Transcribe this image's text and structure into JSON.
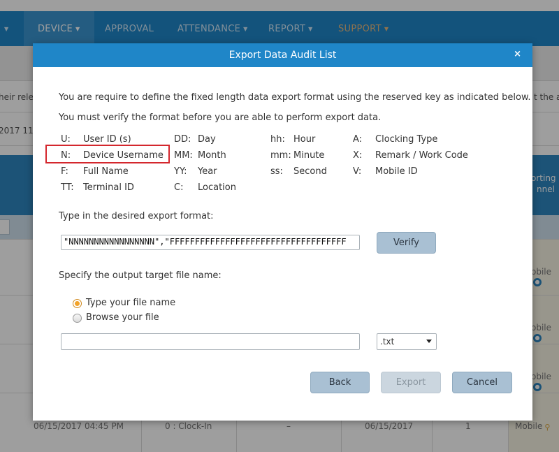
{
  "nav": {
    "items": [
      {
        "label": "DEVICE",
        "caret": "▼"
      },
      {
        "label": "APPROVAL",
        "caret": ""
      },
      {
        "label": "ATTENDANCE",
        "caret": "▼"
      },
      {
        "label": "REPORT",
        "caret": "▼"
      },
      {
        "label": "SUPPORT",
        "caret": "▼"
      }
    ],
    "left_caret": "▼"
  },
  "background": {
    "partial_text_left": "heir rele",
    "partial_text_right": "t the a",
    "date_partial": "2017 11:",
    "column_header_partial_1": "orting",
    "column_header_partial_2": "nnel",
    "channel_values": [
      "obile",
      "obile",
      "obile",
      "Mobile"
    ],
    "last_row": {
      "datetime": "06/15/2017 04:45 PM",
      "type": "0 : Clock-In",
      "dash": "–",
      "date": "06/15/2017",
      "count": "1"
    }
  },
  "dialog": {
    "title": "Export Data Audit List",
    "close": "×",
    "intro1": "You are require to define the fixed length data export format using the reserved key as indicated below.",
    "intro2": "You must verify the format before you are able to perform export data.",
    "keys": [
      [
        {
          "k": "U:",
          "v": "User ID (s)"
        },
        {
          "k": "DD:",
          "v": "Day"
        },
        {
          "k": "hh:",
          "v": "Hour"
        },
        {
          "k": "A:",
          "v": "Clocking Type"
        }
      ],
      [
        {
          "k": "N:",
          "v": "Device Username"
        },
        {
          "k": "MM:",
          "v": "Month"
        },
        {
          "k": "mm:",
          "v": "Minute"
        },
        {
          "k": "X:",
          "v": "Remark / Work Code"
        }
      ],
      [
        {
          "k": "F:",
          "v": "Full Name"
        },
        {
          "k": "YY:",
          "v": "Year"
        },
        {
          "k": "ss:",
          "v": "Second"
        },
        {
          "k": "V:",
          "v": "Mobile ID"
        }
      ],
      [
        {
          "k": "TT:",
          "v": "Terminal ID"
        },
        {
          "k": "C:",
          "v": "Location"
        }
      ]
    ],
    "format_label": "Type in the desired export format:",
    "format_value": "\"NNNNNNNNNNNNNNNNN\",\"FFFFFFFFFFFFFFFFFFFFFFFFFFFFFFFFFFF",
    "verify_label": "Verify",
    "output_label": "Specify the output target file name:",
    "radio_type": "Type your file name",
    "radio_browse": "Browse your file",
    "filename_value": "",
    "extension": ".txt",
    "back_label": "Back",
    "export_label": "Export",
    "cancel_label": "Cancel"
  },
  "colors": {
    "nav_bg": "#1f86c8",
    "highlight_border": "#d4272d",
    "button_bg": "#a9c0d3"
  }
}
